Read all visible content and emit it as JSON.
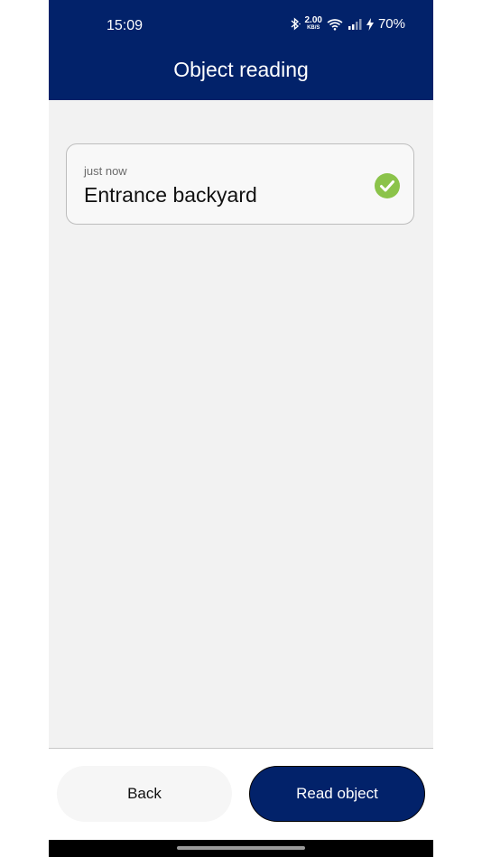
{
  "status_bar": {
    "time": "15:09",
    "network_speed_value": "2.00",
    "network_speed_unit": "KB/S",
    "battery_percent": "70%"
  },
  "header": {
    "title": "Object reading"
  },
  "readings": [
    {
      "time": "just now",
      "name": "Entrance backyard",
      "status_icon": "check-circle-icon"
    }
  ],
  "footer": {
    "back_label": "Back",
    "read_label": "Read object"
  },
  "colors": {
    "primary": "#02226a",
    "success": "#8bc34a",
    "background": "#f2f2f2"
  }
}
